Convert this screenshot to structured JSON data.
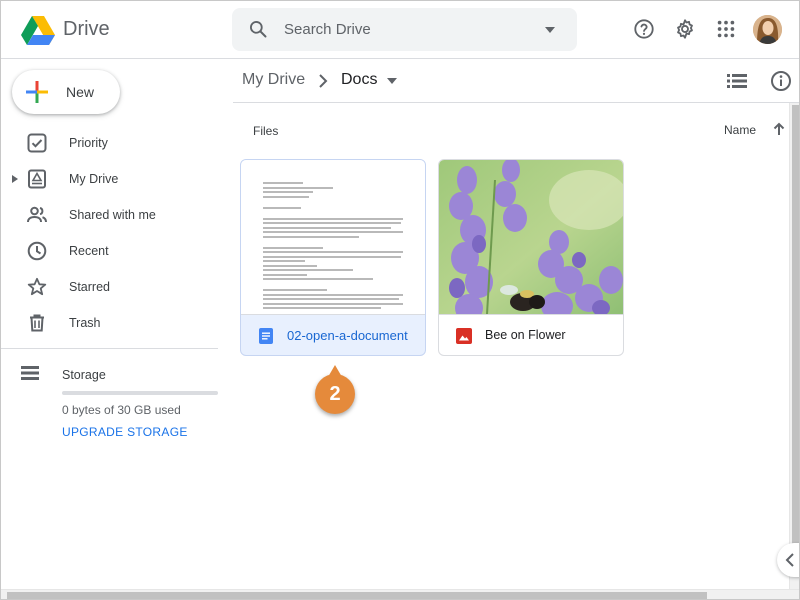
{
  "header": {
    "app_name": "Drive",
    "search_placeholder": "Search Drive",
    "icons": [
      "help-icon",
      "settings-icon",
      "apps-icon",
      "avatar"
    ]
  },
  "sidebar": {
    "new_label": "New",
    "items": [
      {
        "label": "Priority",
        "icon": "priority-icon"
      },
      {
        "label": "My Drive",
        "icon": "my-drive-icon"
      },
      {
        "label": "Shared with me",
        "icon": "shared-icon"
      },
      {
        "label": "Recent",
        "icon": "recent-icon"
      },
      {
        "label": "Starred",
        "icon": "star-icon"
      },
      {
        "label": "Trash",
        "icon": "trash-icon"
      }
    ],
    "storage_label": "Storage",
    "storage_used": "0 bytes of 30 GB used",
    "storage_fraction": 0,
    "upgrade_label": "UPGRADE STORAGE"
  },
  "breadcrumb": {
    "root": "My Drive",
    "current": "Docs"
  },
  "files": {
    "section_label": "Files",
    "sort_label": "Name",
    "items": [
      {
        "name": "02-open-a-document",
        "type": "document",
        "selected": true
      },
      {
        "name": "Bee on Flower",
        "type": "image",
        "selected": false
      }
    ]
  },
  "callout": {
    "step": "2"
  },
  "colors": {
    "accent": "#1a73e8",
    "selected_bg": "#e8f0fe",
    "callout": "#e58a3b",
    "doc_icon": "#4285f4",
    "image_icon": "#d93025"
  }
}
